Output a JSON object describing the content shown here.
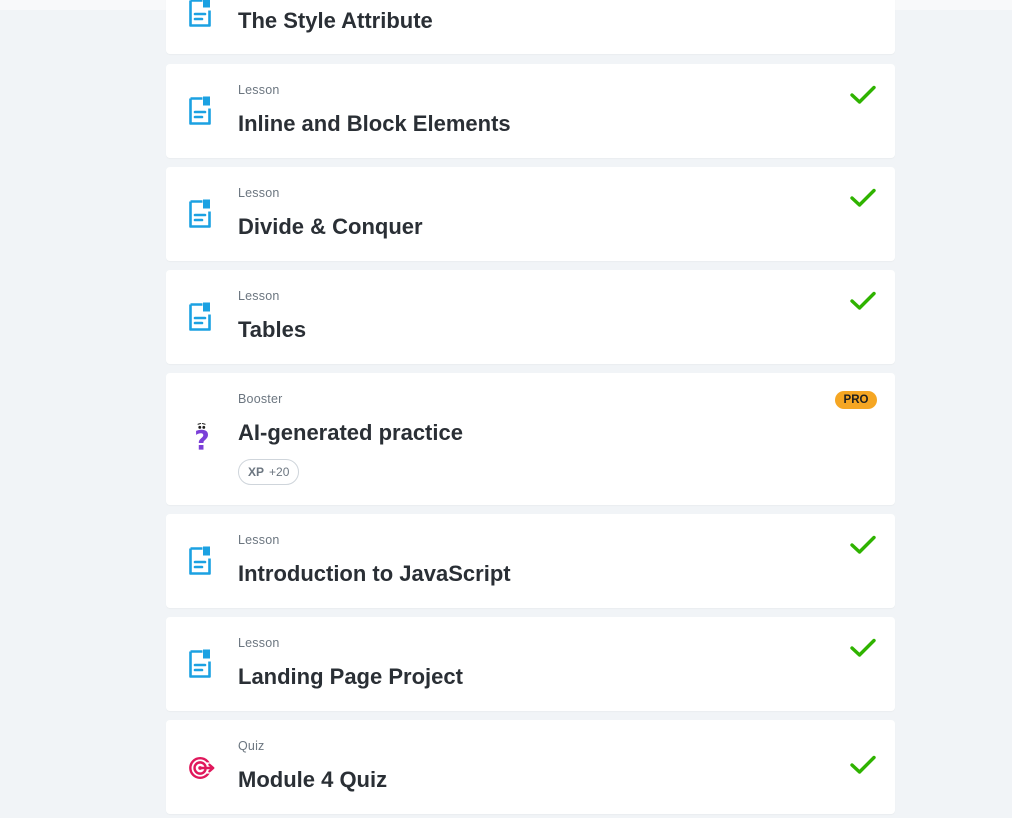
{
  "colors": {
    "page_bg": "#f1f4f7",
    "card_bg": "#ffffff",
    "lesson_icon": "#1ba1e2",
    "booster_icon": "#7b3fd8",
    "quiz_icon": "#e0185c",
    "check": "#2fb300",
    "pro_badge": "#f5a623"
  },
  "items": [
    {
      "kind": "",
      "title": "The Style Attribute",
      "icon": "lesson-document-icon",
      "completed": false
    },
    {
      "kind": "Lesson",
      "title": "Inline and Block Elements",
      "icon": "lesson-document-icon",
      "completed": true
    },
    {
      "kind": "Lesson",
      "title": "Divide & Conquer",
      "icon": "lesson-document-icon",
      "completed": true
    },
    {
      "kind": "Lesson",
      "title": "Tables",
      "icon": "lesson-document-icon",
      "completed": true
    },
    {
      "kind": "Booster",
      "title": "AI-generated practice",
      "icon": "question-mark-icon",
      "badge": "PRO",
      "xp_label": "XP",
      "xp_value": "+20"
    },
    {
      "kind": "Lesson",
      "title": "Introduction to JavaScript",
      "icon": "lesson-document-icon",
      "completed": true
    },
    {
      "kind": "Lesson",
      "title": "Landing Page Project",
      "icon": "lesson-document-icon",
      "completed": true
    },
    {
      "kind": "Quiz",
      "title": "Module 4 Quiz",
      "icon": "target-icon",
      "completed": true
    }
  ]
}
